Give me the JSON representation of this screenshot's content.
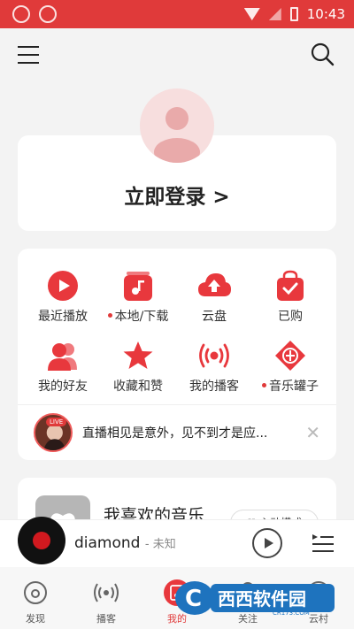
{
  "status_bar": {
    "time": "10:43"
  },
  "login": {
    "label": "立即登录 >"
  },
  "menu": {
    "items": [
      {
        "label": "最近播放",
        "icon": "play-circle-icon",
        "has_dot": false
      },
      {
        "label": "本地/下载",
        "icon": "music-file-icon",
        "has_dot": true
      },
      {
        "label": "云盘",
        "icon": "cloud-upload-icon",
        "has_dot": false
      },
      {
        "label": "已购",
        "icon": "shopping-bag-icon",
        "has_dot": false
      },
      {
        "label": "我的好友",
        "icon": "friends-icon",
        "has_dot": false
      },
      {
        "label": "收藏和赞",
        "icon": "star-icon",
        "has_dot": false
      },
      {
        "label": "我的播客",
        "icon": "broadcast-icon",
        "has_dot": false
      },
      {
        "label": "音乐罐子",
        "icon": "music-jar-icon",
        "has_dot": true
      }
    ],
    "live": {
      "badge": "LIVE",
      "text": "直播相见是意外，见不到才是应..."
    }
  },
  "favorites": {
    "title": "我喜欢的音乐",
    "button_label": "♡ 心动模式"
  },
  "player": {
    "song": "diamond",
    "separator": "- ",
    "artist": "未知"
  },
  "nav": {
    "items": [
      {
        "label": "发现",
        "icon": "discover-icon"
      },
      {
        "label": "播客",
        "icon": "podcast-icon"
      },
      {
        "label": "我的",
        "icon": "my-music-icon",
        "active": true
      },
      {
        "label": "关注",
        "icon": "follow-icon"
      },
      {
        "label": "云村",
        "icon": "cloud-village-icon"
      }
    ]
  },
  "watermark": {
    "text": "西西软件园",
    "sub": "CR173.COM"
  },
  "colors": {
    "accent": "#e03a3a",
    "background": "#f3f3f3"
  }
}
